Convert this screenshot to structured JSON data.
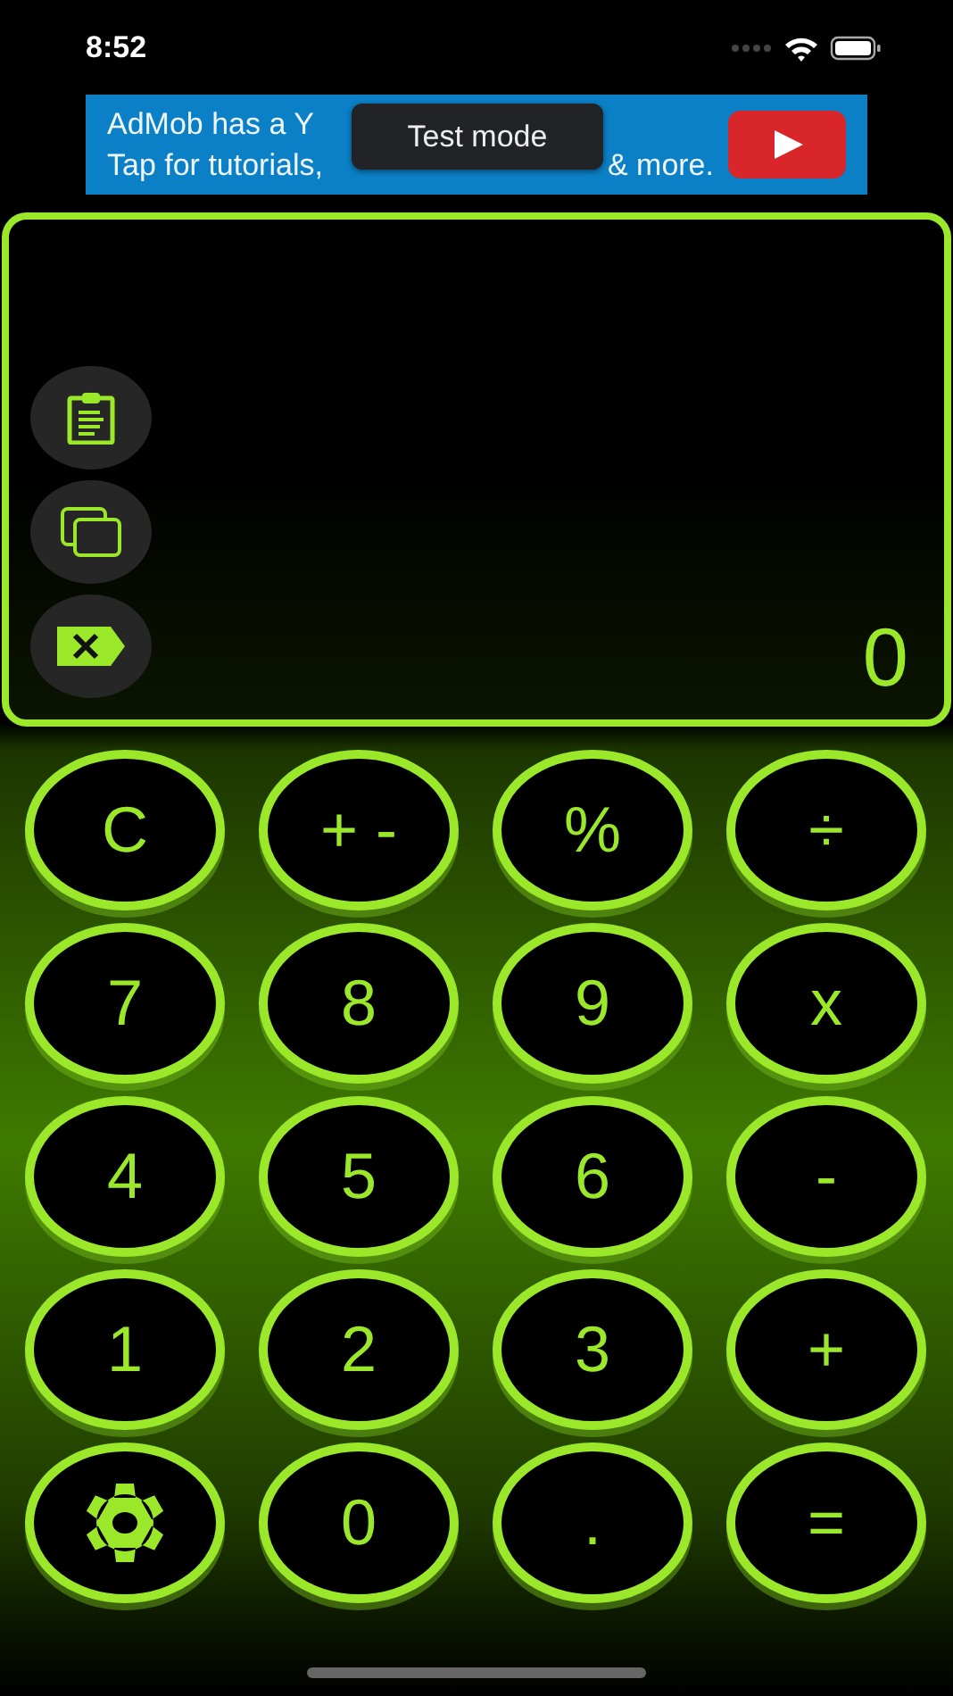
{
  "status_bar": {
    "time": "8:52"
  },
  "ad_banner": {
    "lines": [
      [
        "AdMob has a Y"
      ],
      [
        "Tap for tutorials,",
        "& more."
      ]
    ],
    "toast": "Test mode"
  },
  "display": {
    "value": "0"
  },
  "keys": [
    {
      "kind": "text",
      "label": "C"
    },
    {
      "kind": "text",
      "label": "+ -"
    },
    {
      "kind": "text",
      "label": "%"
    },
    {
      "kind": "text",
      "label": "÷"
    },
    {
      "kind": "text",
      "label": "7"
    },
    {
      "kind": "text",
      "label": "8"
    },
    {
      "kind": "text",
      "label": "9"
    },
    {
      "kind": "text",
      "label": "x"
    },
    {
      "kind": "text",
      "label": "4"
    },
    {
      "kind": "text",
      "label": "5"
    },
    {
      "kind": "text",
      "label": "6"
    },
    {
      "kind": "text",
      "label": "-"
    },
    {
      "kind": "text",
      "label": "1"
    },
    {
      "kind": "text",
      "label": "2"
    },
    {
      "kind": "text",
      "label": "3"
    },
    {
      "kind": "text",
      "label": "+"
    },
    {
      "kind": "settings"
    },
    {
      "kind": "text",
      "label": "0"
    },
    {
      "kind": "text",
      "label": "."
    },
    {
      "kind": "text",
      "label": "="
    }
  ]
}
